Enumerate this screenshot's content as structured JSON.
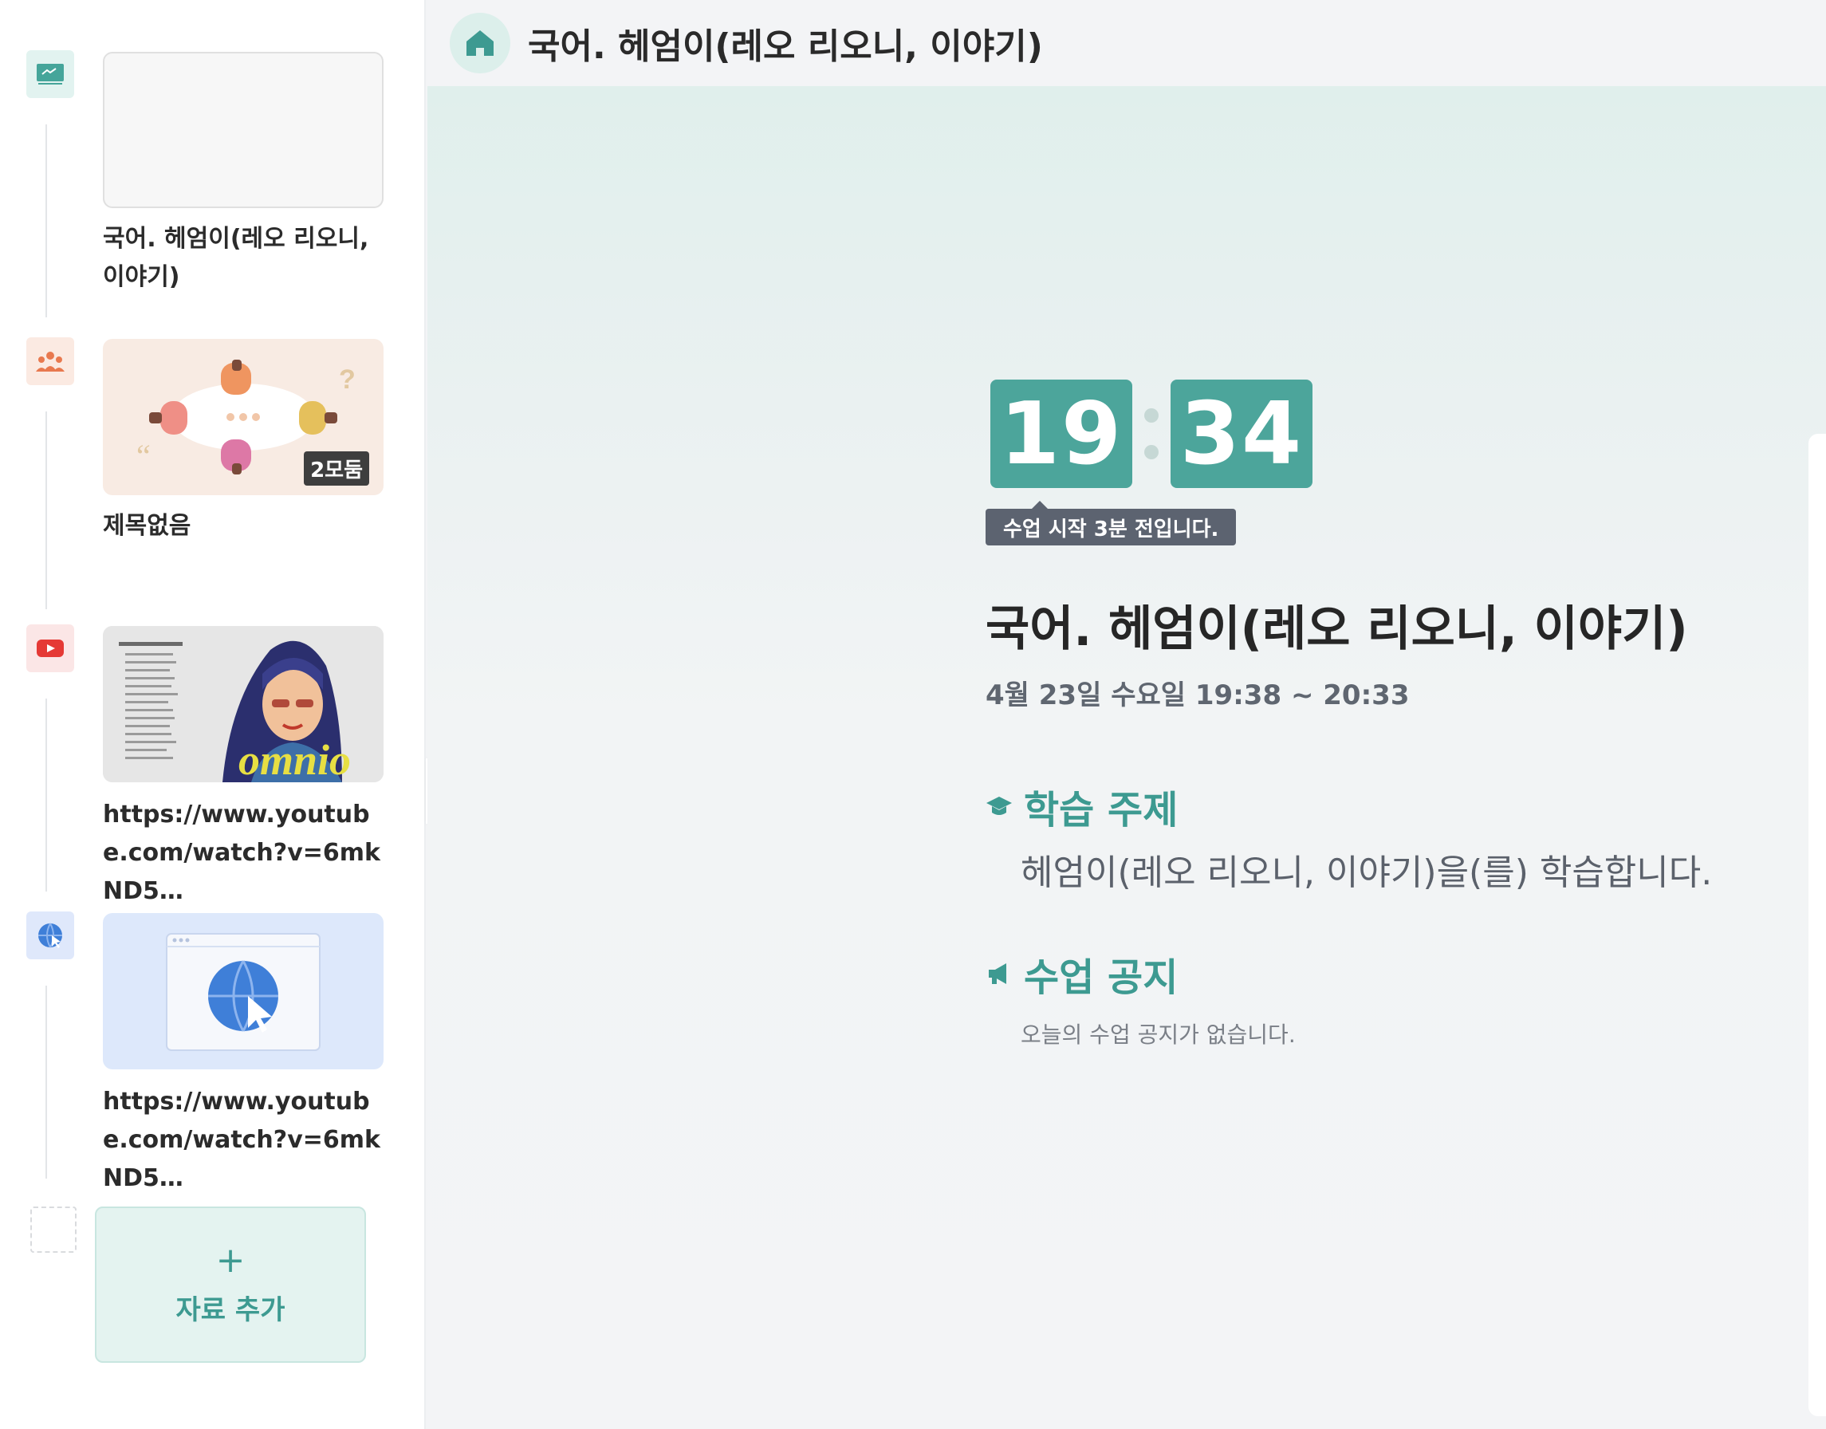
{
  "header": {
    "title": "국어. 헤엄이(레오 리오니, 이야기)"
  },
  "sidebar": {
    "items": [
      {
        "label": "국어. 헤엄이(레오 리오니, 이야기)",
        "icon": "whiteboard-icon",
        "badge": ""
      },
      {
        "label": "제목없음",
        "icon": "group-icon",
        "badge": "2모둠"
      },
      {
        "label": "https://www.youtube.com/watch?v=6mkND5…",
        "icon": "youtube-icon",
        "badge": ""
      },
      {
        "label": "https://www.youtube.com/watch?v=6mkND5…",
        "icon": "web-link-icon",
        "badge": ""
      }
    ],
    "add_button": {
      "plus": "+",
      "label": "자료 추가"
    },
    "collapse_glyph": "<"
  },
  "main": {
    "clock": {
      "hours": "19",
      "minutes": "34"
    },
    "tooltip": "수업 시작 3분 전입니다.",
    "lesson_title": "국어. 헤엄이(레오 리오니, 이야기)",
    "lesson_time": "4월 23일 수요일 19:38 ~ 20:33",
    "topic": {
      "heading": "학습 주제",
      "text": "헤엄이(레오 리오니, 이야기)을(를) 학습합니다."
    },
    "notice": {
      "heading": "수업 공지",
      "text": "오늘의 수업 공지가 없습니다."
    }
  },
  "colors": {
    "accent": "#4ca59b",
    "accent_text": "#3d9a91",
    "tooltip_bg": "#5c6370"
  }
}
